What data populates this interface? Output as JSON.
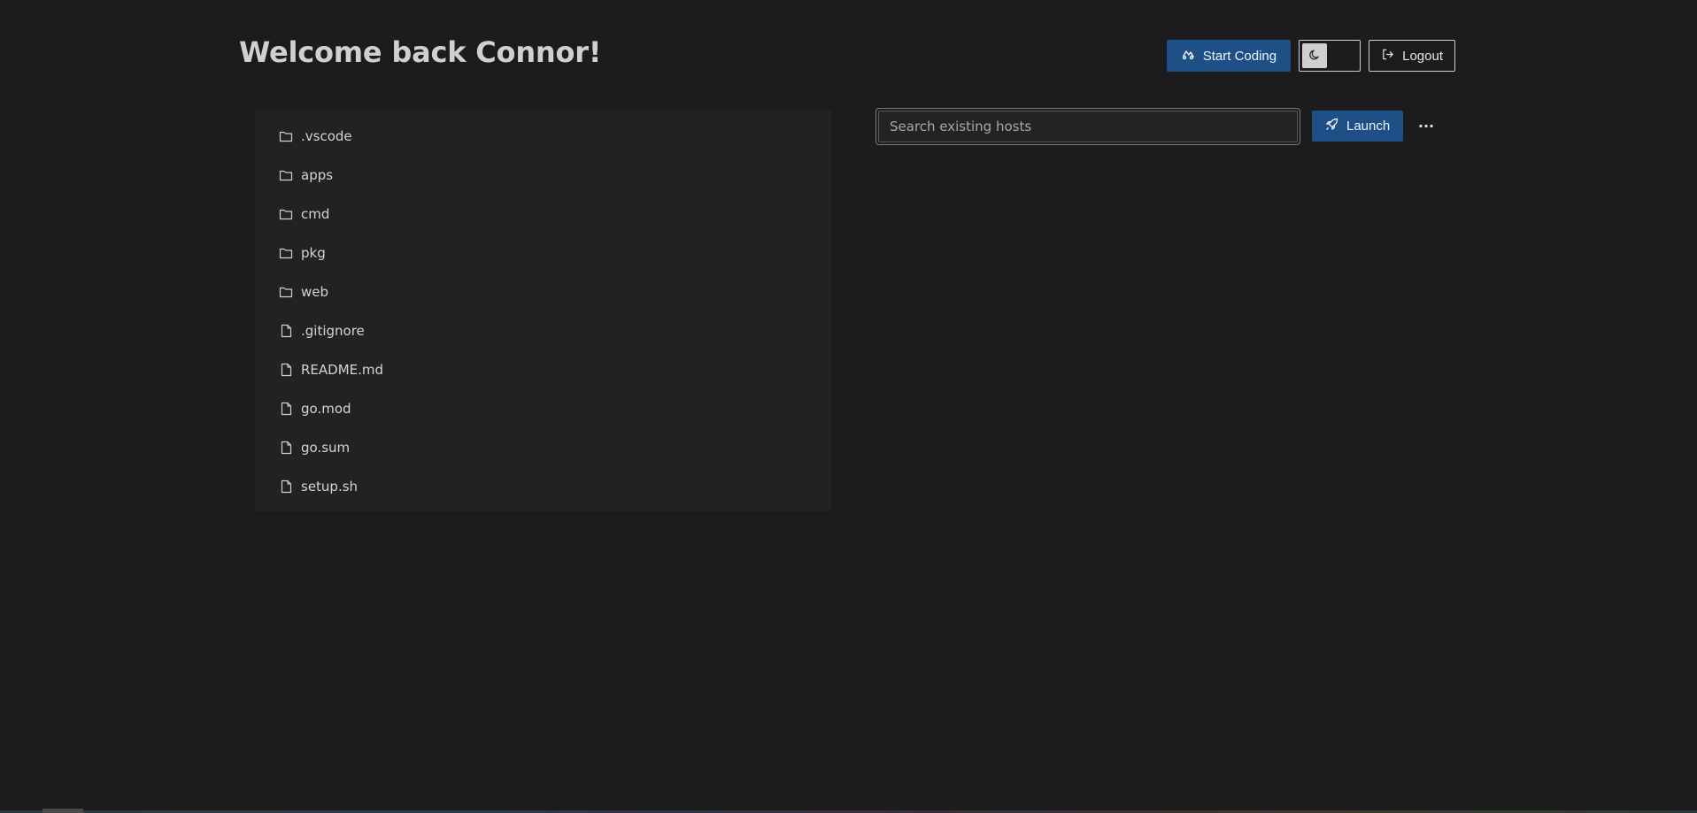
{
  "header": {
    "title": "Welcome back Connor!",
    "start_coding_label": "Start Coding",
    "logout_label": "Logout",
    "theme_mode": "dark"
  },
  "files": [
    {
      "name": ".vscode",
      "type": "folder"
    },
    {
      "name": "apps",
      "type": "folder"
    },
    {
      "name": "cmd",
      "type": "folder"
    },
    {
      "name": "pkg",
      "type": "folder"
    },
    {
      "name": "web",
      "type": "folder"
    },
    {
      "name": ".gitignore",
      "type": "file"
    },
    {
      "name": "README.md",
      "type": "file"
    },
    {
      "name": "go.mod",
      "type": "file"
    },
    {
      "name": "go.sum",
      "type": "file"
    },
    {
      "name": "setup.sh",
      "type": "file"
    }
  ],
  "hosts": {
    "search_placeholder": "Search existing hosts",
    "search_value": "",
    "launch_label": "Launch",
    "more_label": "···"
  },
  "colors": {
    "background": "#1c1c1c",
    "panel": "#222222",
    "accent": "#1e4f86"
  }
}
